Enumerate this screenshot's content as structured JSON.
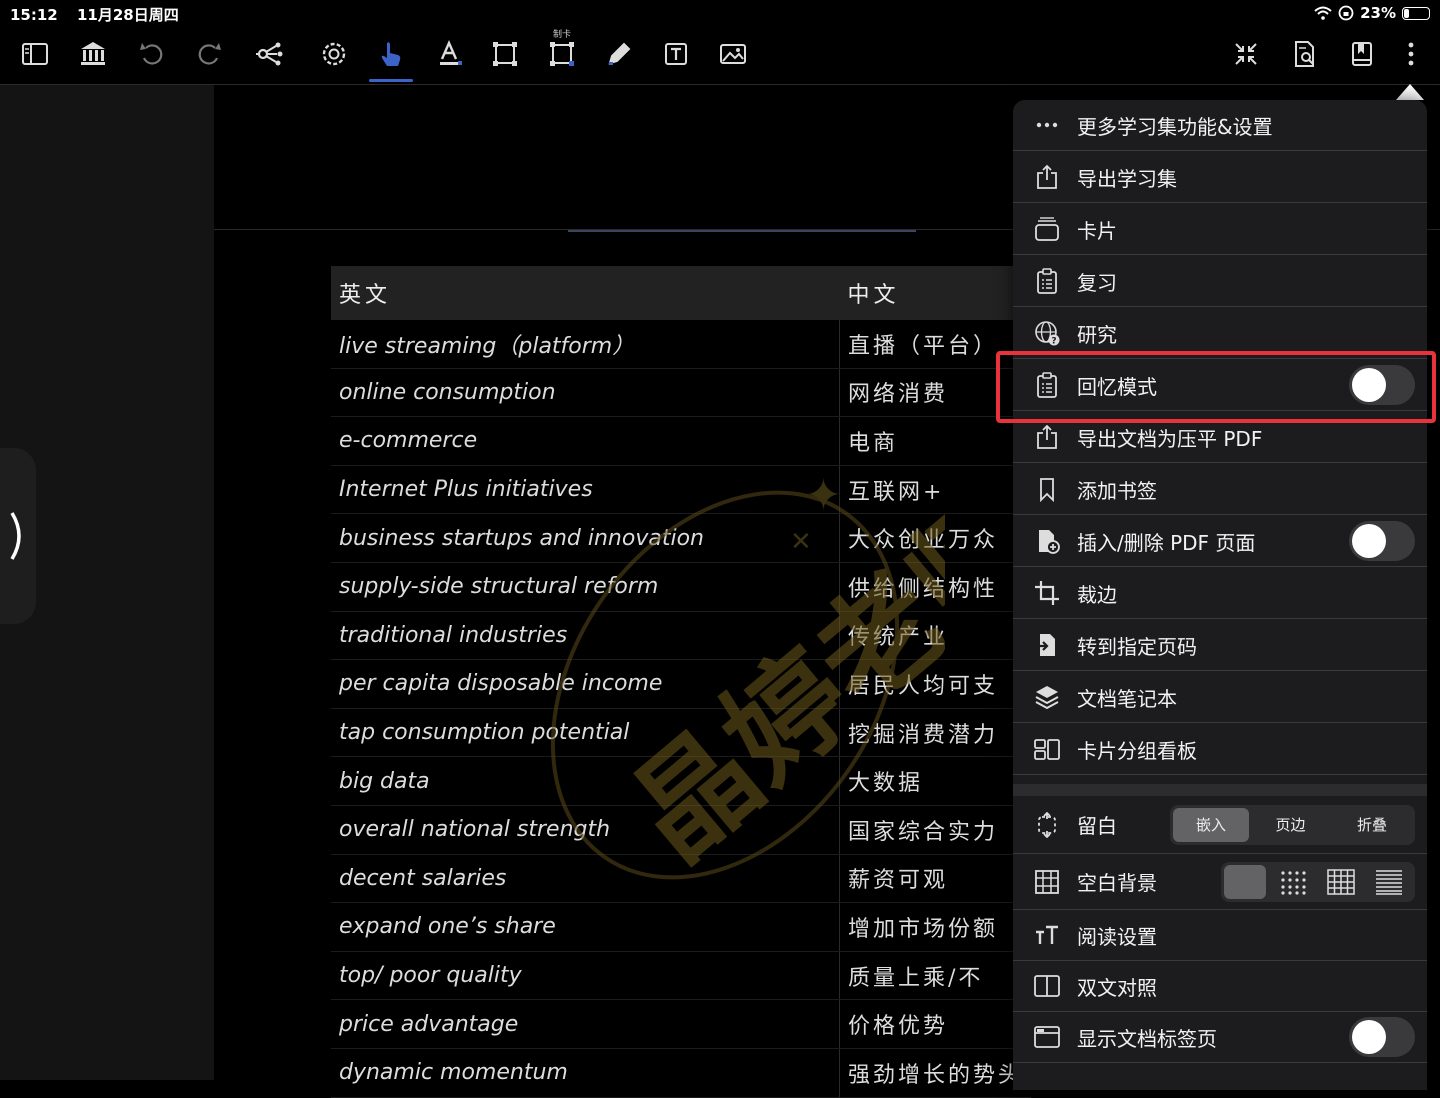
{
  "status_bar": {
    "time": "15:12",
    "date": "11月28日周四",
    "battery": "23%",
    "battery_level": 0.23
  },
  "toolbar": {
    "card_caption": "制卡",
    "left_tools": [
      "sidebar-icon",
      "library-icon",
      "undo-icon",
      "redo-icon",
      "mindmap-icon",
      "settings-gear-icon",
      "hand-pointer-icon",
      "text-highlight-icon",
      "select-rect-icon",
      "card-rect-icon",
      "pencil-icon",
      "textbox-icon",
      "image-icon"
    ],
    "right_tools": [
      "collapse-icon",
      "doc-search-icon",
      "bookmark-book-icon",
      "more-vertical-icon"
    ],
    "active_tool": "hand-pointer-icon"
  },
  "table": {
    "headers": [
      "英文",
      "中文"
    ],
    "rows": [
      [
        "live streaming（platform）",
        "直播（平台）"
      ],
      [
        "online consumption",
        "网络消费"
      ],
      [
        "e-commerce",
        "电商"
      ],
      [
        "Internet Plus initiatives",
        "互联网+"
      ],
      [
        "business startups and innovation",
        "大众创业万众"
      ],
      [
        "supply-side structural reform",
        "供给侧结构性"
      ],
      [
        "traditional industries",
        "传统产业"
      ],
      [
        "per capita disposable income",
        "居民人均可支"
      ],
      [
        "tap consumption potential",
        "挖掘消费潜力"
      ],
      [
        "big data",
        "大数据"
      ],
      [
        "overall national strength",
        "国家综合实力"
      ],
      [
        "decent salaries",
        "薪资可观"
      ],
      [
        "expand one’s share",
        "增加市场份额"
      ],
      [
        "top/ poor quality",
        "质量上乘/不"
      ],
      [
        "price advantage",
        "价格优势"
      ],
      [
        "dynamic momentum",
        "强劲增长的势头"
      ]
    ]
  },
  "menu": {
    "items": [
      {
        "label": "更多学习集功能&设置",
        "icon": "ellipsis-icon"
      },
      {
        "label": "导出学习集",
        "icon": "share-icon"
      },
      {
        "label": "卡片",
        "icon": "cards-stack-icon"
      },
      {
        "label": "复习",
        "icon": "clipboard-list-icon"
      },
      {
        "label": "研究",
        "icon": "www-globe-icon"
      },
      {
        "label": "回忆模式",
        "icon": "clipboard-list-icon",
        "toggle": false
      },
      {
        "label": "导出文档为压平 PDF",
        "icon": "share-icon"
      },
      {
        "label": "添加书签",
        "icon": "bookmark-icon"
      },
      {
        "label": "插入/删除 PDF 页面",
        "icon": "doc-add-icon",
        "toggle": false
      },
      {
        "label": "裁边",
        "icon": "crop-icon"
      },
      {
        "label": "转到指定页码",
        "icon": "doc-goto-icon"
      },
      {
        "label": "文档笔记本",
        "icon": "layers-icon"
      },
      {
        "label": "卡片分组看板",
        "icon": "board-icon"
      }
    ],
    "margin": {
      "label": "留白",
      "icon": "margin-arrows-icon",
      "options": [
        "嵌入",
        "页边",
        "折叠"
      ],
      "selected": "嵌入"
    },
    "background": {
      "label": "空白背景",
      "icon": "grid-icon",
      "options": [
        "blank-swatch-icon",
        "dots-swatch-icon",
        "grid-swatch-icon",
        "lines-swatch-icon"
      ],
      "selected": "blank-swatch-icon"
    },
    "bottom_items": [
      {
        "label": "阅读设置",
        "icon": "text-size-icon"
      },
      {
        "label": "双文对照",
        "icon": "split-view-icon"
      },
      {
        "label": "显示文档标签页",
        "icon": "browser-tab-icon",
        "toggle": false
      }
    ]
  },
  "colors": {
    "accent": "#3c64c8",
    "highlight": "#e8323c",
    "menu_bg": "#1c1c1e",
    "toggle_off": "#3a3a3c"
  }
}
